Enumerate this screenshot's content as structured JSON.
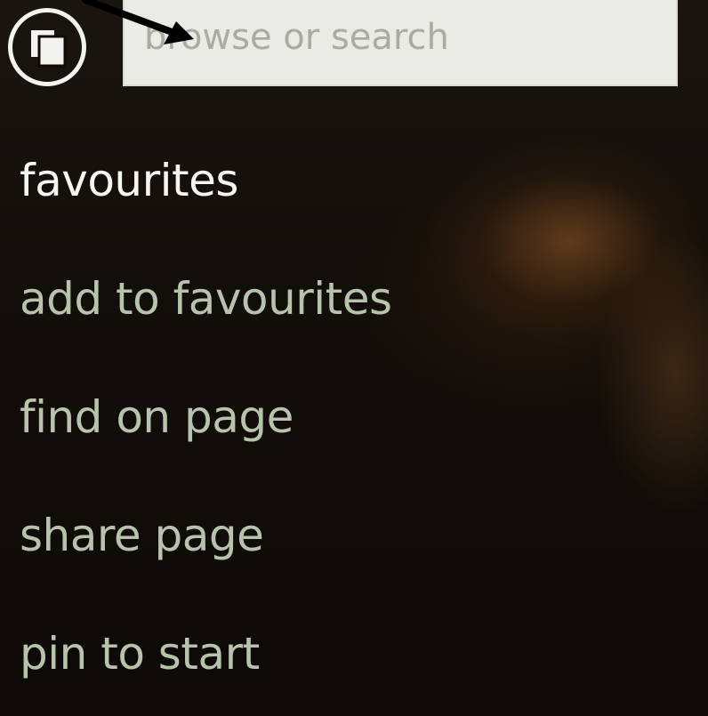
{
  "search": {
    "placeholder": "browse or search",
    "value": ""
  },
  "tabs_button": {
    "icon": "tabs-icon"
  },
  "annotation": {
    "icon": "arrow-icon",
    "color": "#000000"
  },
  "menu": {
    "items": [
      {
        "label": "favourites"
      },
      {
        "label": "add to favourites"
      },
      {
        "label": "find on page"
      },
      {
        "label": "share page"
      },
      {
        "label": "pin to start"
      }
    ]
  },
  "colors": {
    "background": "#100c08",
    "menu_text": "#b8c3ac",
    "menu_text_active": "#f6f6f2",
    "search_box": "#e9ebe4",
    "placeholder": "#a8aca3",
    "icon_stroke": "#f3f3ef"
  }
}
